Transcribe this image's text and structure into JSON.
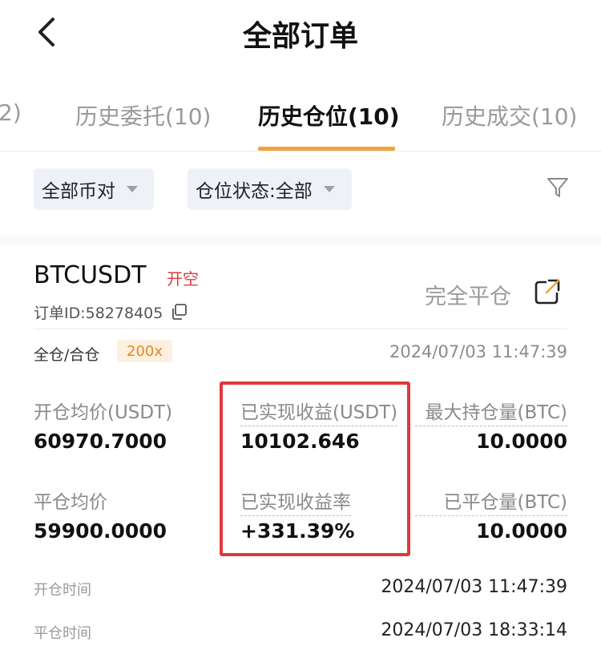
{
  "header": {
    "title": "全部订单"
  },
  "tabs": [
    {
      "label": "2)"
    },
    {
      "label": "历史委托(10)"
    },
    {
      "label": "历史仓位(10)"
    },
    {
      "label": "历史成交(10)"
    }
  ],
  "filters": {
    "pair": "全部币对",
    "status": "仓位状态:全部"
  },
  "position": {
    "symbol": "BTCUSDT",
    "side": "开空",
    "close_label": "完全平仓",
    "order_id": "订单ID:58278405",
    "margin_mode": "全仓/合仓",
    "leverage": "200x",
    "header_time": "2024/07/03 11:47:39",
    "fields": {
      "entry_price_label": "开仓均价(USDT)",
      "entry_price": "60970.7000",
      "realized_pnl_label": "已实现收益(USDT)",
      "realized_pnl": "10102.646",
      "max_position_label": "最大持仓量(BTC)",
      "max_position": "10.0000",
      "exit_price_label": "平仓均价",
      "exit_price": "59900.0000",
      "realized_pnl_rate_label": "已实现收益率",
      "realized_pnl_rate": "+331.39%",
      "closed_qty_label": "已平仓量(BTC)",
      "closed_qty": "10.0000"
    },
    "open_time_label": "开仓时间",
    "open_time": "2024/07/03 11:47:39",
    "close_time_label": "平仓时间",
    "close_time": "2024/07/03 18:33:14"
  },
  "colors": {
    "accent": "#f3a23a",
    "short_red": "#d64040",
    "highlight_red": "#e0393c",
    "leverage_bg": "#fdf0e1",
    "leverage_text": "#e08a22"
  }
}
